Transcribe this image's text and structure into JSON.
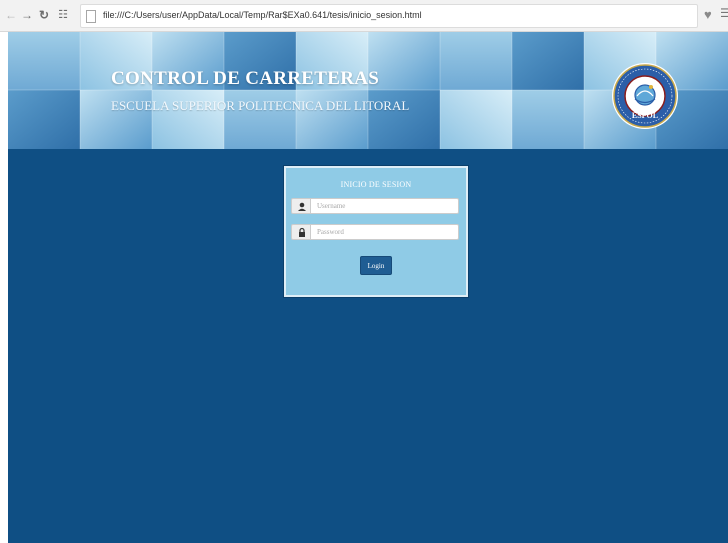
{
  "browser": {
    "back_icon": "back-arrow-icon",
    "forward_icon": "forward-arrow-icon",
    "reload_icon": "reload-icon",
    "apps_icon": "apps-icon",
    "address": "file:///C:/Users/user/AppData/Local/Temp/Rar$EXa0.641/tesis/inicio_sesion.html",
    "bookmark_icon": "heart-icon"
  },
  "header": {
    "title": "CONTROL DE CARRETERAS",
    "subtitle": "ESCUELA SUPERIOR POLITECNICA DEL LITORAL",
    "logo_text": "ESPOL"
  },
  "login": {
    "title": "INICIO DE SESION",
    "username_placeholder": "Username",
    "password_placeholder": "Password",
    "button_label": "Login"
  },
  "colors": {
    "page_background": "#0f4f84",
    "banner": "#7fb7da",
    "login_box": "#8fcbe6",
    "button": "#1f5d93"
  }
}
